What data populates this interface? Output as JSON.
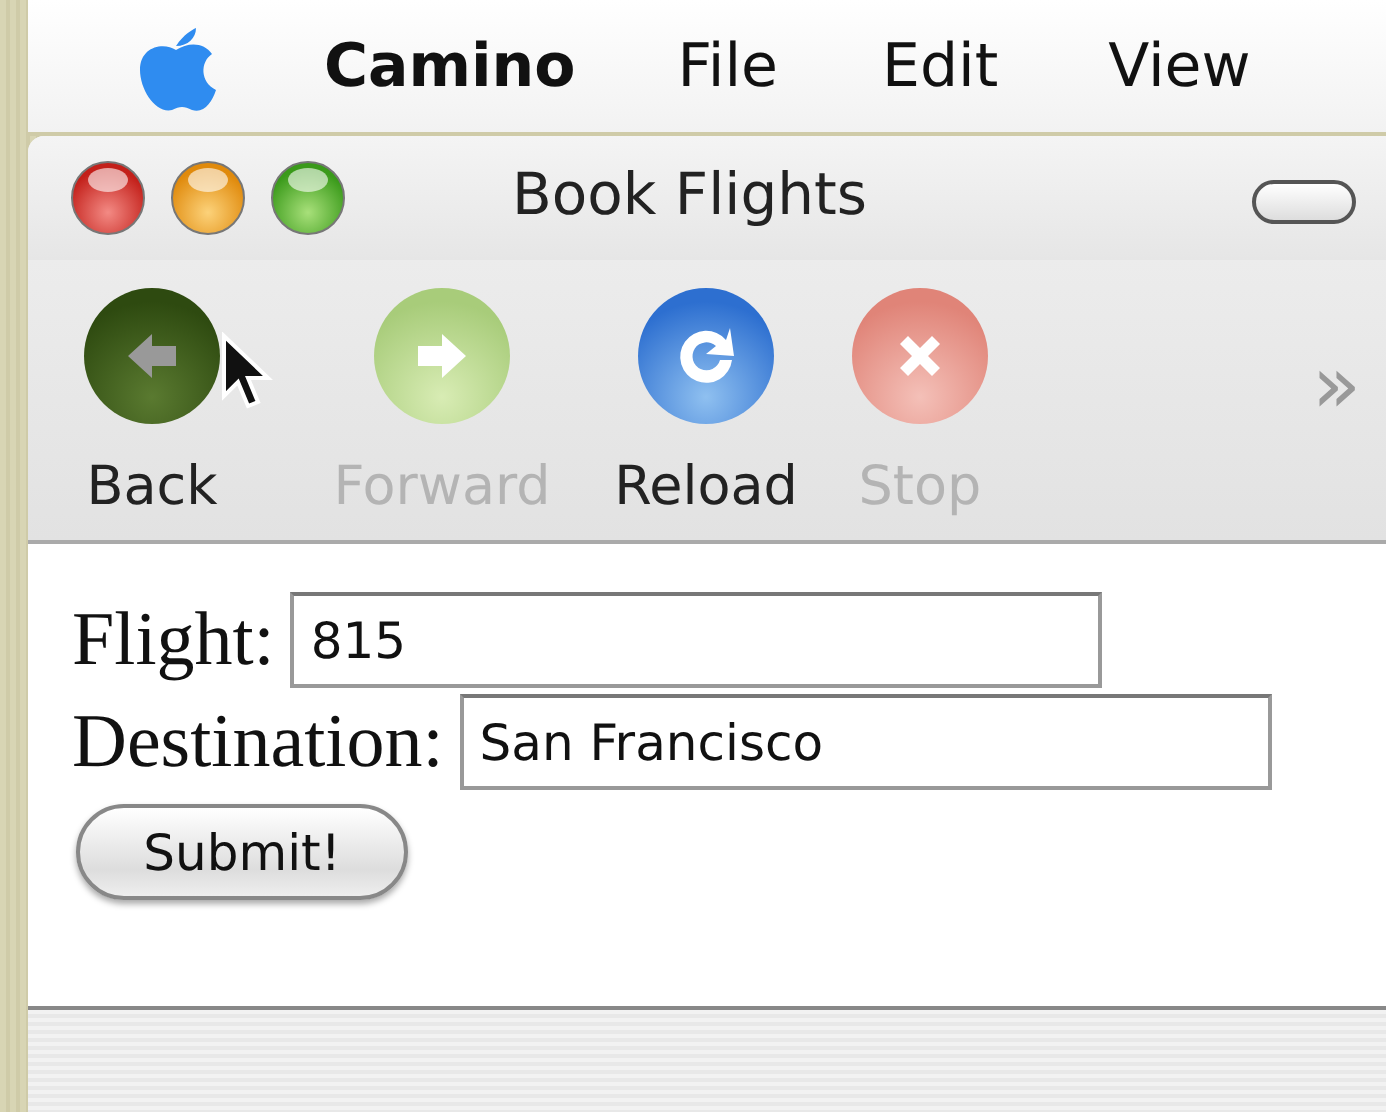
{
  "menu_bar": {
    "app_name": "Camino",
    "items": [
      "File",
      "Edit",
      "View"
    ]
  },
  "window": {
    "title": "Book Flights"
  },
  "toolbar": {
    "buttons": [
      {
        "kind": "back",
        "label": "Back",
        "disabled": false,
        "pressed": true
      },
      {
        "kind": "forward",
        "label": "Forward",
        "disabled": true,
        "pressed": false
      },
      {
        "kind": "reload",
        "label": "Reload",
        "disabled": false,
        "pressed": false
      },
      {
        "kind": "stop",
        "label": "Stop",
        "disabled": true,
        "pressed": false
      }
    ],
    "overflow": "»"
  },
  "form": {
    "fields": [
      {
        "label": "Flight:",
        "value": "815"
      },
      {
        "label": "Destination:",
        "value": "San Francisco"
      }
    ],
    "submit": "Submit!"
  }
}
